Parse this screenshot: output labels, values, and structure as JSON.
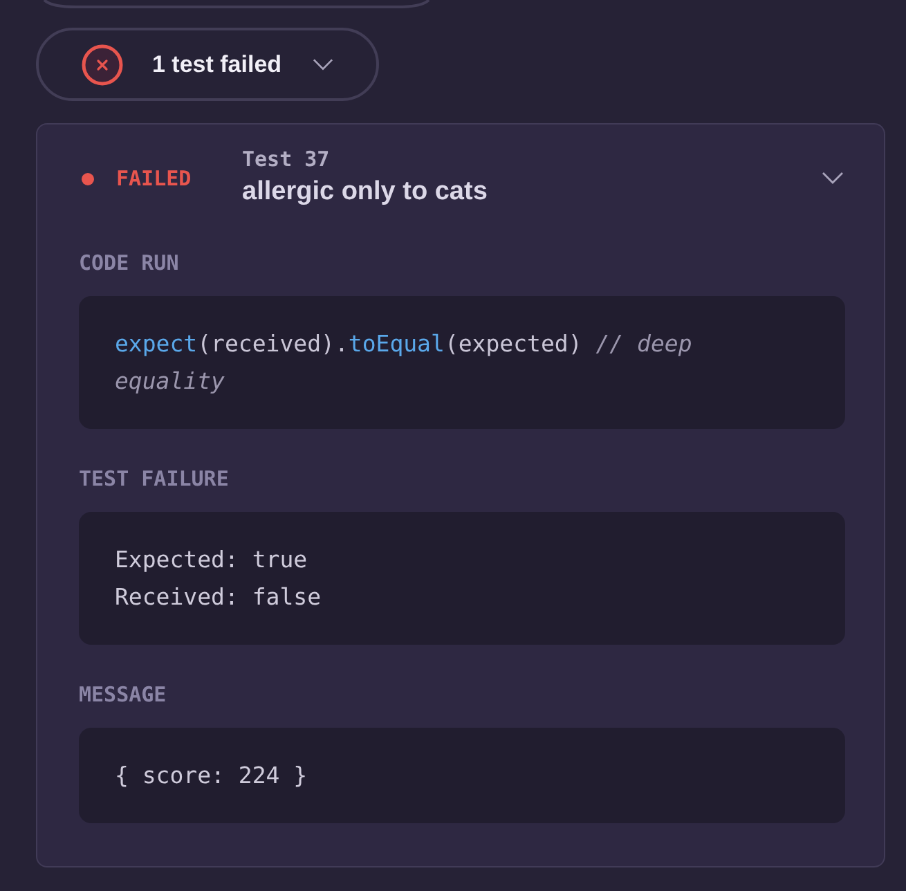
{
  "summary": {
    "failed": true,
    "label": "1 test failed"
  },
  "result": {
    "failed": true,
    "status_label": "FAILED",
    "test_number": "Test 37",
    "title": "allergic only to cats",
    "sections": [
      {
        "kind": "code",
        "heading": "CODE RUN",
        "tokens": [
          {
            "kind": "function",
            "text": "expect"
          },
          {
            "kind": "plain",
            "text": "(received)."
          },
          {
            "kind": "function",
            "text": "toEqual"
          },
          {
            "kind": "plain",
            "text": "(expected) "
          },
          {
            "kind": "comment",
            "text": "// deep equality"
          }
        ]
      },
      {
        "kind": "output",
        "heading": "TEST FAILURE",
        "lines": [
          "Expected: true",
          "Received: false"
        ]
      },
      {
        "kind": "output",
        "heading": "MESSAGE",
        "lines": [
          "{ score: 224 }"
        ]
      }
    ]
  }
}
